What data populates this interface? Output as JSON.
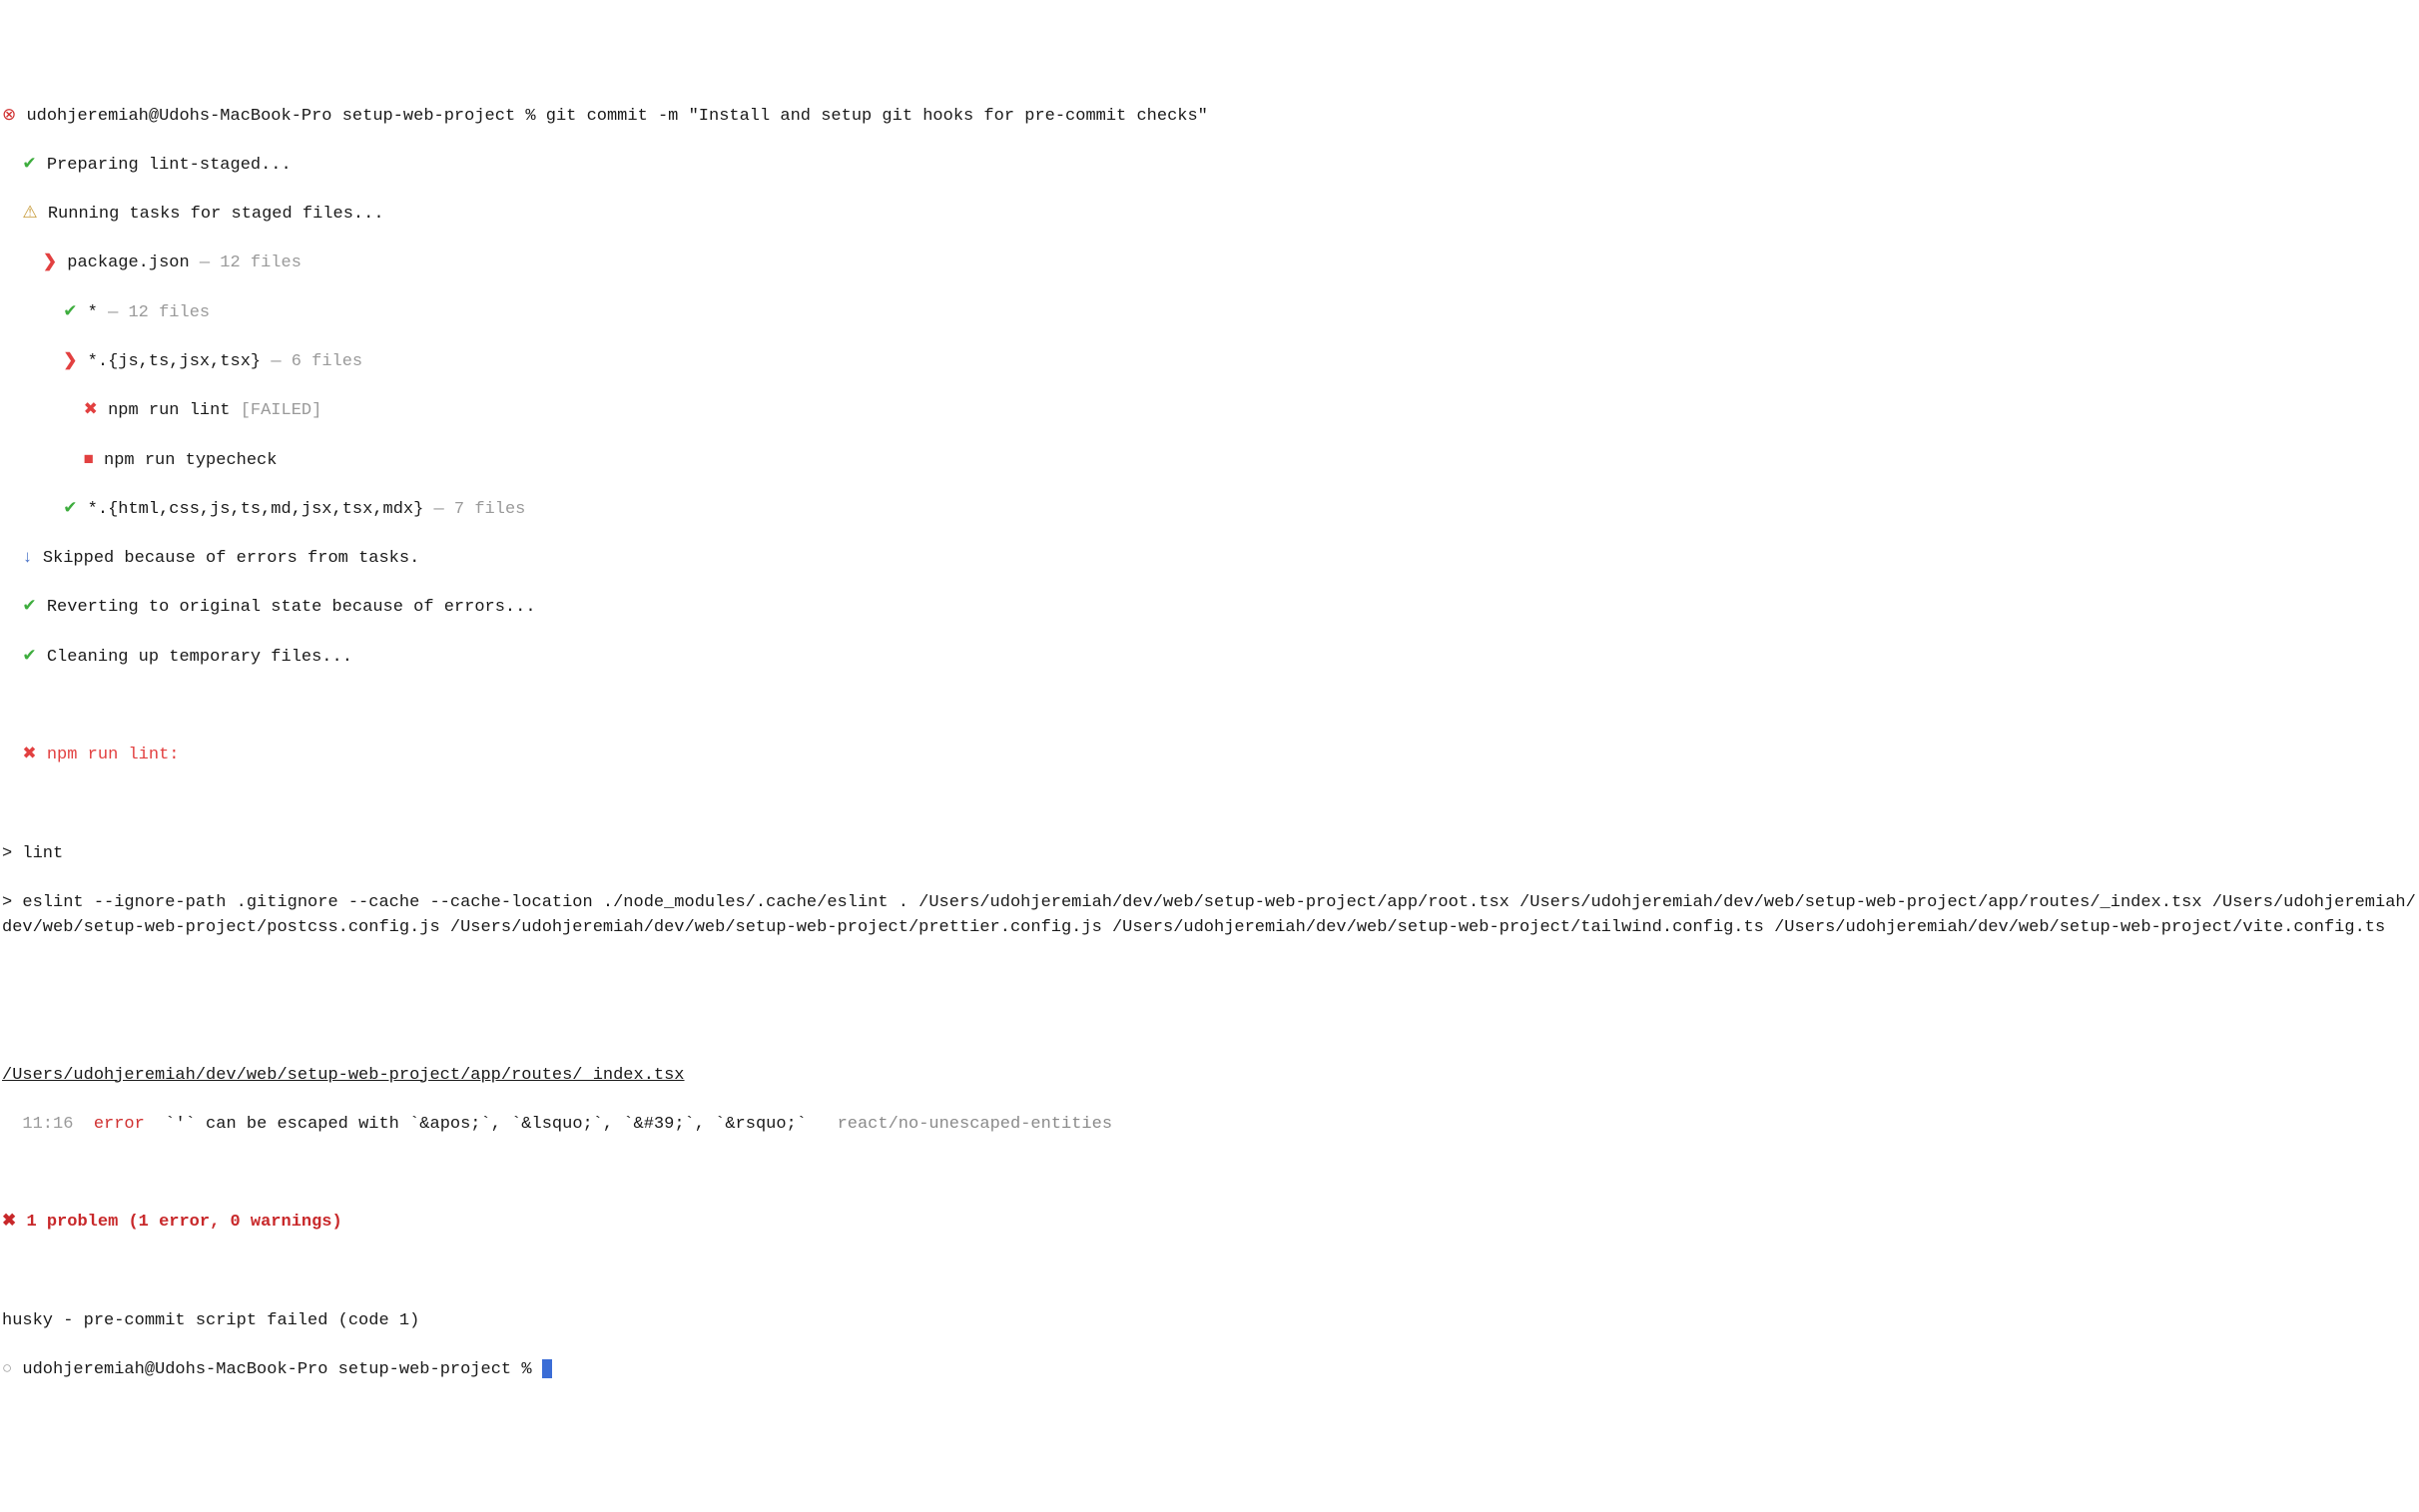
{
  "prompt1": {
    "bullet": "⊗",
    "user": "udohjeremiah@Udohs-MacBook-Pro",
    "dir": "setup-web-project",
    "sep": "%",
    "cmd": "git commit -m \"Install and setup git hooks for pre-commit checks\""
  },
  "ls": {
    "prep": {
      "icon": "✔",
      "text": "Preparing lint-staged..."
    },
    "run": {
      "icon": "⚠",
      "text": "Running tasks for staged files..."
    },
    "pkg": {
      "icon": "❯",
      "text": "package.json",
      "suffix": "— 12 files"
    },
    "star": {
      "icon": "✔",
      "text": "*",
      "suffix": "— 12 files"
    },
    "jsglob": {
      "icon": "❯",
      "text": "*.{js,ts,jsx,tsx}",
      "suffix": "— 6 files"
    },
    "lint": {
      "icon": "✖",
      "text": "npm run lint",
      "suffix": "[FAILED]"
    },
    "tc": {
      "icon": "■",
      "text": "npm run typecheck"
    },
    "html": {
      "icon": "✔",
      "text": "*.{html,css,js,ts,md,jsx,tsx,mdx}",
      "suffix": "— 7 files"
    },
    "skip": {
      "icon": "↓",
      "text": "Skipped because of errors from tasks."
    },
    "revert": {
      "icon": "✔",
      "text": "Reverting to original state because of errors..."
    },
    "clean": {
      "icon": "✔",
      "text": "Cleaning up temporary files..."
    }
  },
  "fail_header": {
    "icon": "✖",
    "text": "npm run lint:"
  },
  "lint_out": {
    "l1": "> lint",
    "l2": "> eslint --ignore-path .gitignore --cache --cache-location ./node_modules/.cache/eslint . /Users/udohjeremiah/dev/web/setup-web-project/app/root.tsx /Users/udohjeremiah/dev/web/setup-web-project/app/routes/_index.tsx /Users/udohjeremiah/dev/web/setup-web-project/postcss.config.js /Users/udohjeremiah/dev/web/setup-web-project/prettier.config.js /Users/udohjeremiah/dev/web/setup-web-project/tailwind.config.ts /Users/udohjeremiah/dev/web/setup-web-project/vite.config.ts"
  },
  "err": {
    "file": "/Users/udohjeremiah/dev/web/setup-web-project/app/routes/_index.tsx",
    "loc": "  11:16",
    "level": "error",
    "msg": "`'` can be escaped with `&apos;`, `&lsquo;`, `&#39;`, `&rsquo;`",
    "rule": "react/no-unescaped-entities"
  },
  "summary": {
    "icon": "✖",
    "text": "1 problem (1 error, 0 warnings)"
  },
  "husky": "husky - pre-commit script failed (code 1)",
  "prompt2": {
    "bullet": "○",
    "user": "udohjeremiah@Udohs-MacBook-Pro",
    "dir": "setup-web-project",
    "sep": "%"
  }
}
